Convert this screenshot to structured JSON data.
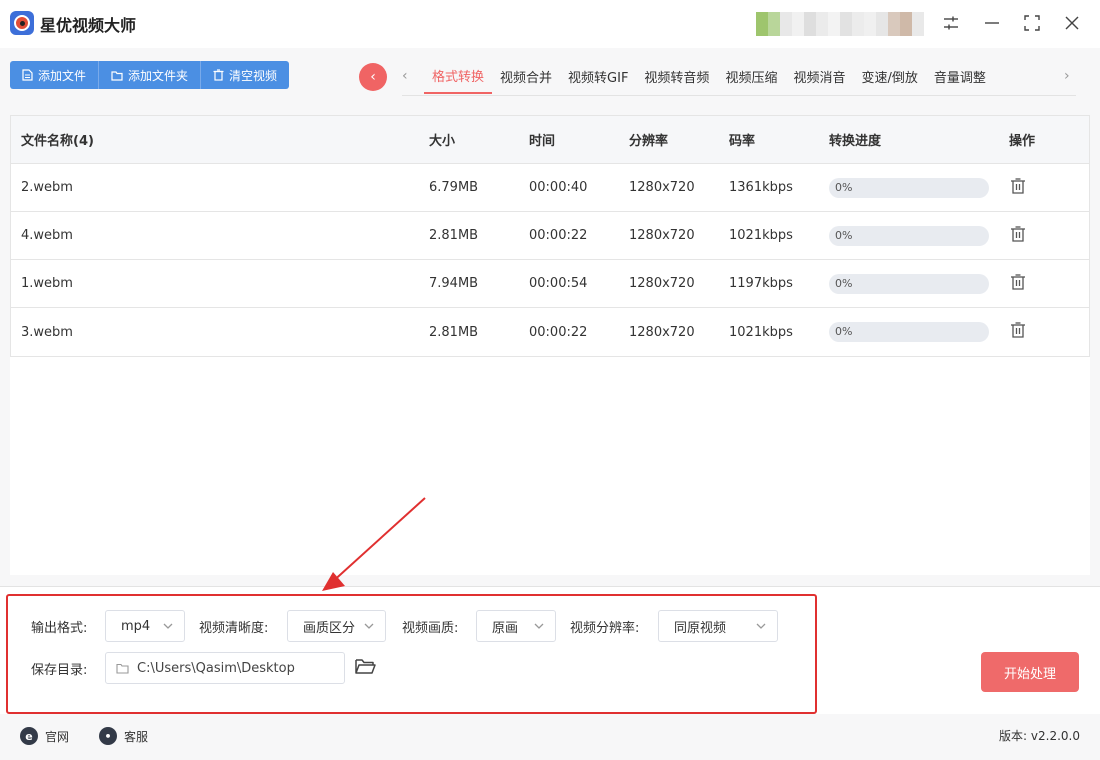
{
  "app": {
    "title": "星优视频大师"
  },
  "toolbar": {
    "add_file": "添加文件",
    "add_folder": "添加文件夹",
    "clear": "清空视频"
  },
  "tabs": [
    {
      "label": "格式转换",
      "active": true
    },
    {
      "label": "视频合并"
    },
    {
      "label": "视频转GIF"
    },
    {
      "label": "视频转音频"
    },
    {
      "label": "视频压缩"
    },
    {
      "label": "视频消音"
    },
    {
      "label": "变速/倒放"
    },
    {
      "label": "音量调整"
    }
  ],
  "table": {
    "headers": {
      "name": "文件名称(4)",
      "size": "大小",
      "time": "时间",
      "resolution": "分辨率",
      "bitrate": "码率",
      "progress": "转换进度",
      "action": "操作"
    },
    "rows": [
      {
        "name": "2.webm",
        "size": "6.79MB",
        "time": "00:00:40",
        "resolution": "1280x720",
        "bitrate": "1361kbps",
        "progress_label": "0%",
        "progress": 0
      },
      {
        "name": "4.webm",
        "size": "2.81MB",
        "time": "00:00:22",
        "resolution": "1280x720",
        "bitrate": "1021kbps",
        "progress_label": "0%",
        "progress": 0
      },
      {
        "name": "1.webm",
        "size": "7.94MB",
        "time": "00:00:54",
        "resolution": "1280x720",
        "bitrate": "1197kbps",
        "progress_label": "0%",
        "progress": 0
      },
      {
        "name": "3.webm",
        "size": "2.81MB",
        "time": "00:00:22",
        "resolution": "1280x720",
        "bitrate": "1021kbps",
        "progress_label": "0%",
        "progress": 0
      }
    ]
  },
  "settings": {
    "output_format_label": "输出格式:",
    "output_format_value": "mp4",
    "clarity_label": "视频清晰度:",
    "clarity_value": "画质区分",
    "quality_label": "视频画质:",
    "quality_value": "原画",
    "resolution_label": "视频分辨率:",
    "resolution_value": "同原视频",
    "save_dir_label": "保存目录:",
    "save_dir_value": "C:\\Users\\Qasim\\Desktop",
    "start_button": "开始处理"
  },
  "footer": {
    "website": "官网",
    "support": "客服",
    "version": "版本: v2.2.0.0"
  },
  "colors": {
    "accent": "#f06464",
    "primary": "#4b8fe3",
    "highlight": "#e03030"
  }
}
